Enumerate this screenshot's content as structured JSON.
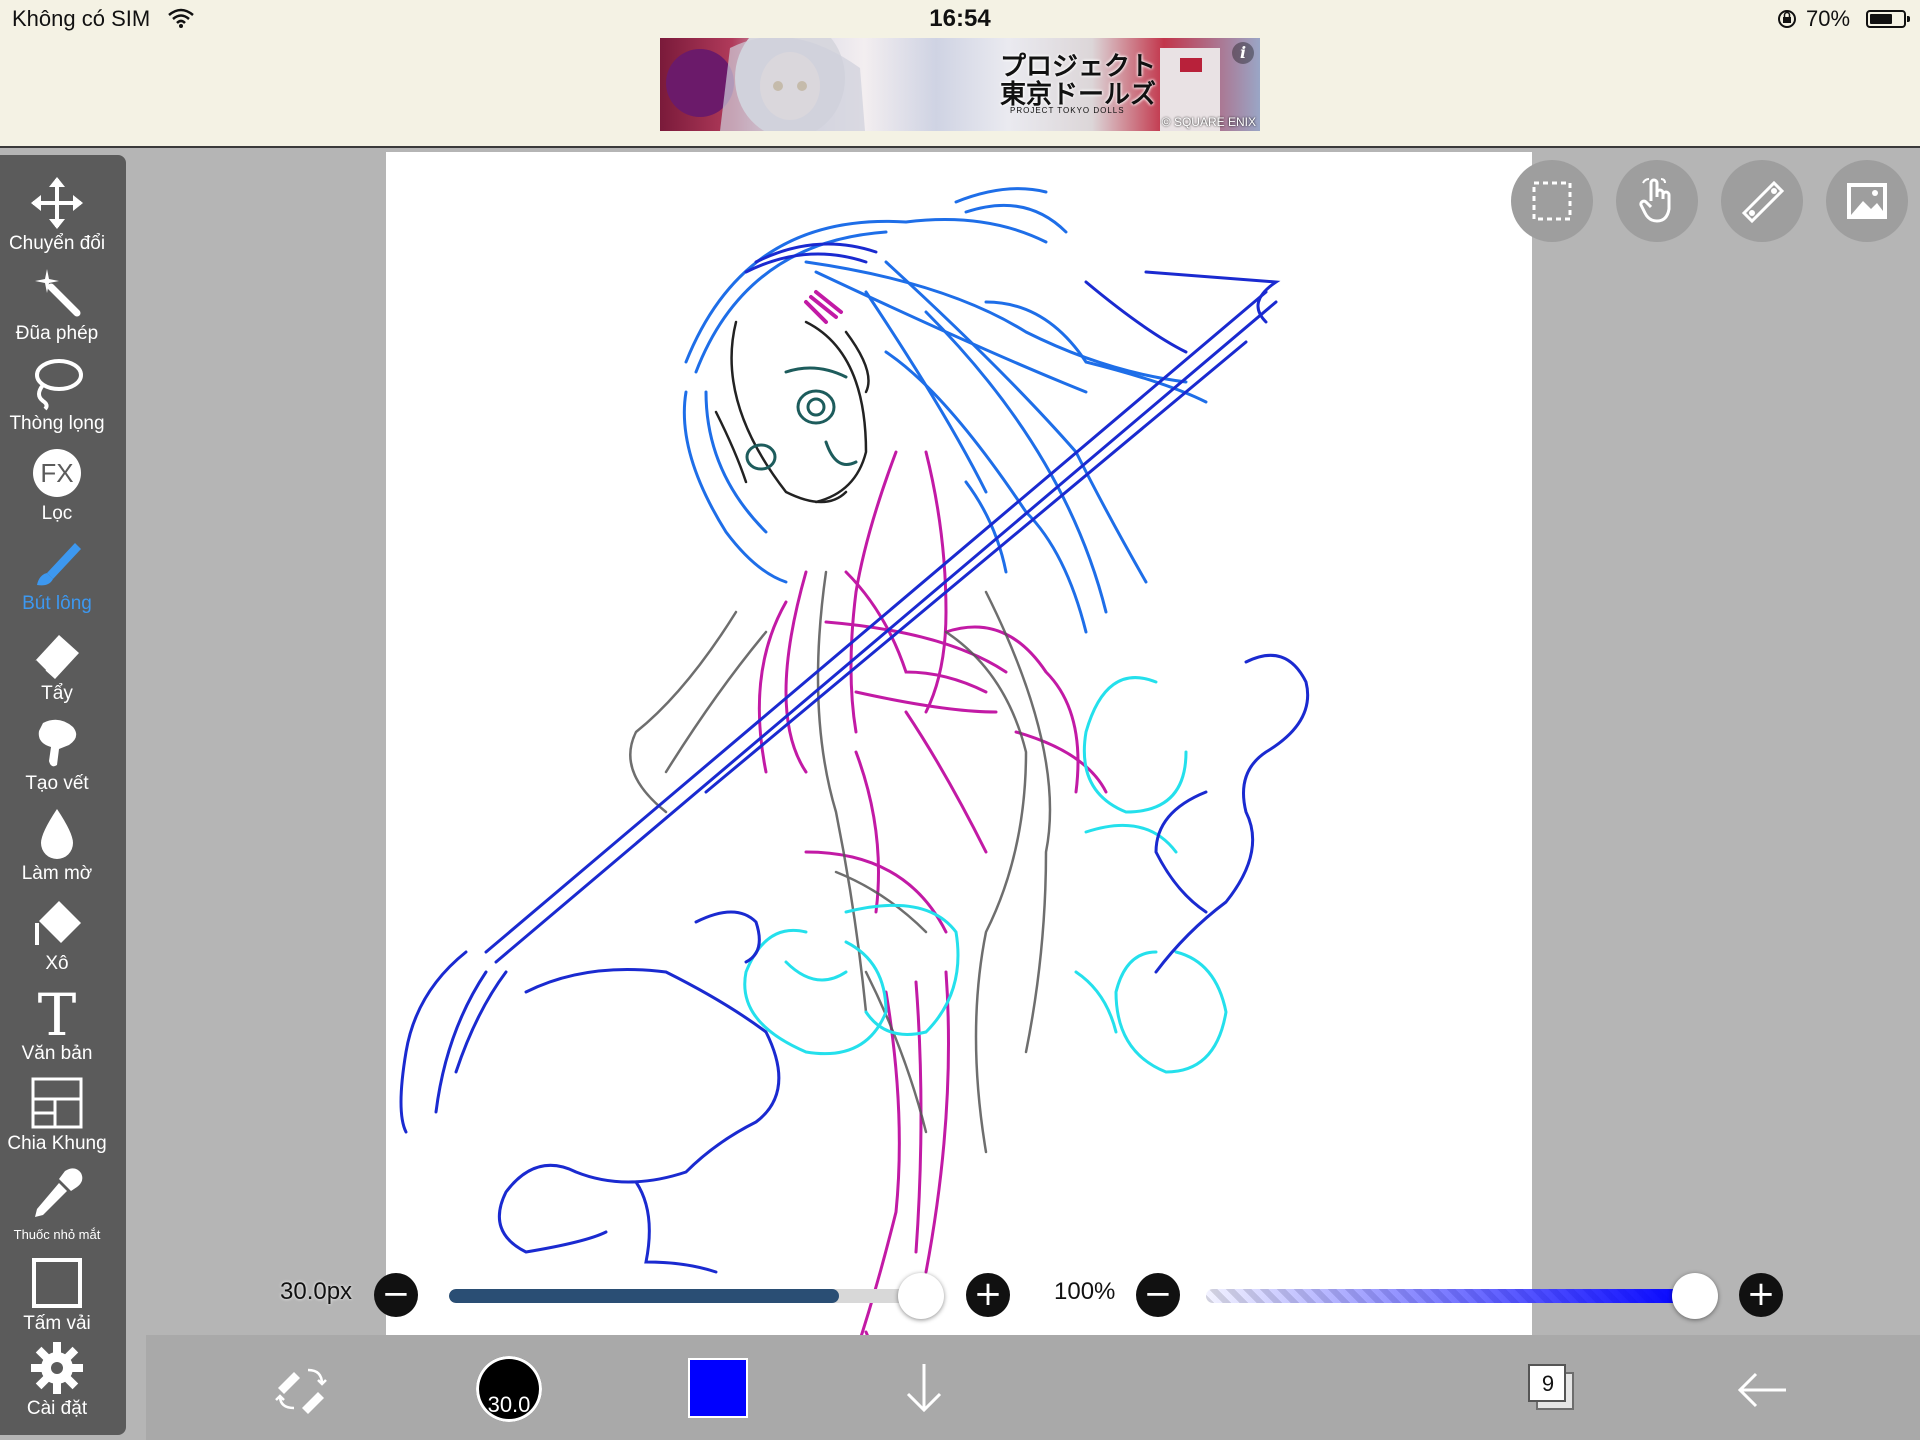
{
  "status_bar": {
    "carrier": "Không có SIM",
    "time": "16:54",
    "battery_percent": "70%",
    "battery_level": 0.7,
    "icons": [
      "wifi-icon",
      "rotation-lock-icon",
      "battery-icon"
    ]
  },
  "ad": {
    "title": "プロジェクト東京ドールズ",
    "subtitle": "PROJECT TOKYO DOLLS",
    "copyright": "© SQUARE ENIX",
    "info_icon": "i"
  },
  "toolbar": {
    "items": [
      {
        "label": "Chuyển đổi",
        "icon": "transform-icon",
        "active": false
      },
      {
        "label": "Đũa phép",
        "icon": "magic-wand-icon",
        "active": false
      },
      {
        "label": "Thòng lọng",
        "icon": "lasso-icon",
        "active": false
      },
      {
        "label": "Lọc",
        "icon": "fx-filter-icon",
        "active": false
      },
      {
        "label": "Bút lông",
        "icon": "brush-icon",
        "active": true
      },
      {
        "label": "Tẩy",
        "icon": "eraser-icon",
        "active": false
      },
      {
        "label": "Tạo vết",
        "icon": "smudge-icon",
        "active": false
      },
      {
        "label": "Làm mờ",
        "icon": "blur-drop-icon",
        "active": false
      },
      {
        "label": "Xô",
        "icon": "bucket-icon",
        "active": false
      },
      {
        "label": "Văn bản",
        "icon": "text-icon",
        "active": false
      },
      {
        "label": "Chia Khung",
        "icon": "frame-divider-icon",
        "active": false
      },
      {
        "label": "Thuốc nhỏ mắt",
        "icon": "eyedropper-icon",
        "active": false
      },
      {
        "label": "Tấm vải",
        "icon": "canvas-icon",
        "active": false
      },
      {
        "label": "Cài đặt",
        "icon": "gear-icon",
        "active": false
      }
    ]
  },
  "canvas_tools": [
    "selection-icon",
    "hand-gesture-icon",
    "ruler-icon",
    "image-icon"
  ],
  "sliders": {
    "size": {
      "label": "30.0px",
      "value_fraction": 0.82
    },
    "opacity": {
      "label": "100%",
      "value_fraction": 1.0
    }
  },
  "bottom_bar": {
    "brush_size_label": "30.0",
    "current_color": "#0000ff",
    "layer_count": "9"
  },
  "colors": {
    "active_tool": "#3d98f0",
    "toolbar_bg": "#5b5b5b",
    "slider_fill": "#2a4e74",
    "sketch_blue": "#1a2ad0",
    "sketch_lightblue": "#1e6ee8",
    "sketch_magenta": "#c21aa5",
    "sketch_cyan": "#24e0ec",
    "sketch_gray": "#555555",
    "sketch_teal": "#1d5c5c"
  }
}
